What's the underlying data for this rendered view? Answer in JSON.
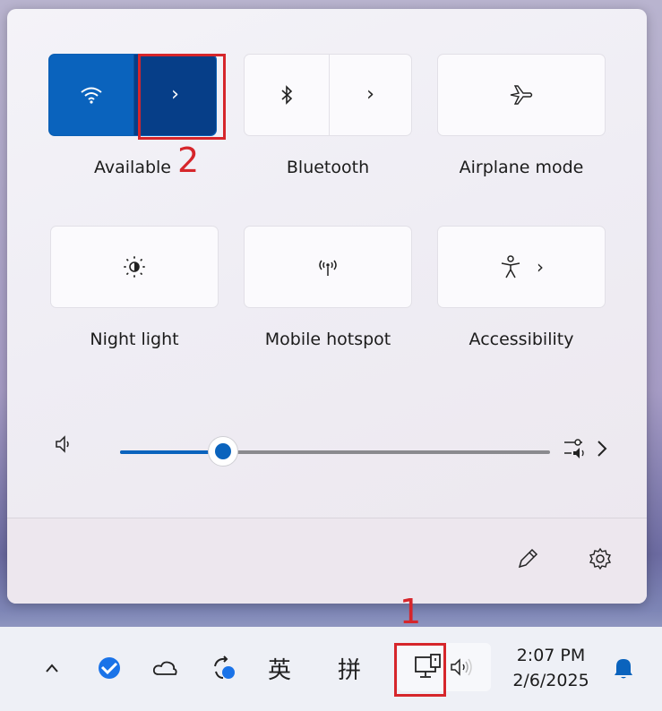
{
  "quick_settings": {
    "tiles_row1": [
      {
        "label": "Available",
        "icon": "wifi-icon",
        "state": "on"
      },
      {
        "label": "Bluetooth",
        "icon": "bluetooth-icon",
        "state": "off"
      },
      {
        "label": "Airplane mode",
        "icon": "airplane-icon",
        "state": "off"
      }
    ],
    "tiles_row2": [
      {
        "label": "Night light",
        "icon": "brightness-icon"
      },
      {
        "label": "Mobile hotspot",
        "icon": "hotspot-icon"
      },
      {
        "label": "Accessibility",
        "icon": "accessibility-icon"
      }
    ],
    "volume": {
      "level_percent": 24
    },
    "footer": {
      "edit_icon": "pencil-icon",
      "settings_icon": "gear-icon"
    }
  },
  "annotations": {
    "first": "1",
    "second": "2"
  },
  "taskbar": {
    "ime_lang": "英",
    "ime_mode": "拼",
    "time": "2:07 PM",
    "date": "2/6/2025"
  },
  "colors": {
    "accent": "#0a63bd",
    "accent_dark": "#063e88",
    "annotation": "#d6262b"
  }
}
